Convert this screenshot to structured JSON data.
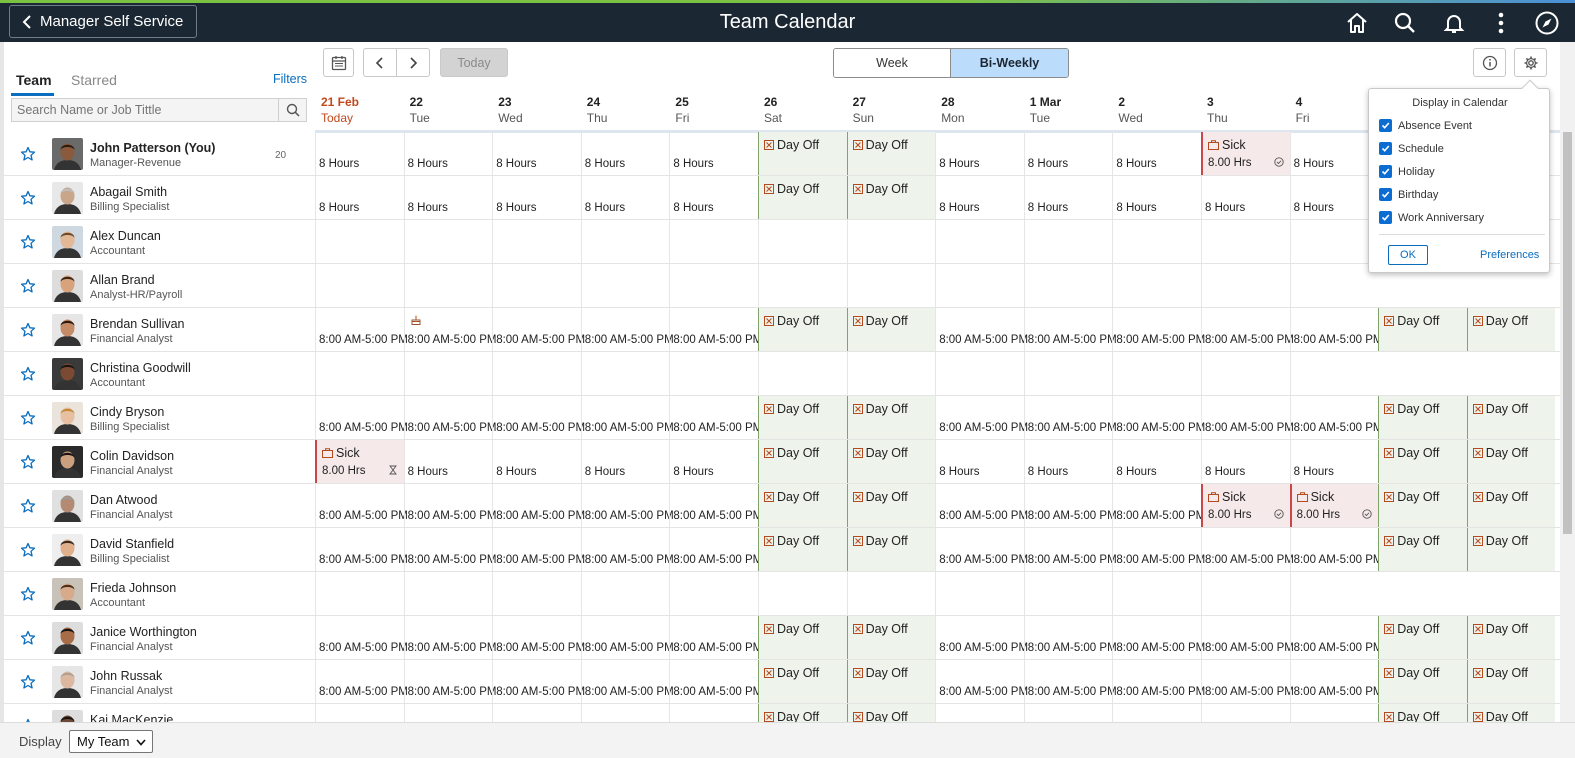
{
  "header": {
    "back_label": "Manager Self Service",
    "title": "Team Calendar",
    "icons": [
      "home-icon",
      "search-icon",
      "notifications-icon",
      "more-actions-icon",
      "navbar-icon"
    ]
  },
  "left": {
    "tabs": [
      {
        "label": "Team",
        "active": true
      },
      {
        "label": "Starred",
        "active": false
      }
    ],
    "filters_label": "Filters",
    "search_placeholder": "Search Name or Job Tittle"
  },
  "toolbar": {
    "today_label": "Today",
    "views": [
      {
        "label": "Week",
        "active": false
      },
      {
        "label": "Bi-Weekly",
        "active": true
      }
    ]
  },
  "dates": [
    {
      "num": "21 Feb",
      "day": "Today",
      "today": true
    },
    {
      "num": "22",
      "day": "Tue"
    },
    {
      "num": "23",
      "day": "Wed"
    },
    {
      "num": "24",
      "day": "Thu"
    },
    {
      "num": "25",
      "day": "Fri"
    },
    {
      "num": "26",
      "day": "Sat"
    },
    {
      "num": "27",
      "day": "Sun"
    },
    {
      "num": "28",
      "day": "Mon"
    },
    {
      "num": "1 Mar",
      "day": "Tue"
    },
    {
      "num": "2",
      "day": "Wed"
    },
    {
      "num": "3",
      "day": "Thu"
    },
    {
      "num": "4",
      "day": "Fri"
    }
  ],
  "labels": {
    "day_off": "Day Off",
    "sick": "Sick",
    "sick_hours": "8.00 Hrs",
    "hours": "8 Hours",
    "shift": "8:00 AM-5:00 PM"
  },
  "employees": [
    {
      "name": "John Patterson (You)",
      "job": "Manager-Revenue",
      "count": "20",
      "me": true,
      "sched": "hours",
      "sick": [
        10
      ],
      "sickStatus": "approved",
      "weekendExtra": false
    },
    {
      "name": "Abagail Smith",
      "job": "Billing Specialist",
      "sched": "hours",
      "sick": [],
      "weekendExtra": false
    },
    {
      "name": "Alex Duncan",
      "job": "Accountant",
      "sched": "none",
      "sick": [],
      "weekendExtra": false
    },
    {
      "name": "Allan Brand",
      "job": "Analyst-HR/Payroll",
      "sched": "none",
      "sick": [],
      "weekendExtra": false
    },
    {
      "name": "Brendan Sullivan",
      "job": "Financial Analyst",
      "sched": "shift",
      "sick": [],
      "birthday": 1,
      "weekendExtra": true
    },
    {
      "name": "Christina Goodwill",
      "job": "Accountant",
      "sched": "none",
      "sick": [],
      "weekendExtra": false
    },
    {
      "name": "Cindy Bryson",
      "job": "Billing Specialist",
      "sched": "shift",
      "sick": [],
      "weekendExtra": true
    },
    {
      "name": "Colin Davidson",
      "job": "Financial Analyst",
      "sched": "hours",
      "sick": [
        0
      ],
      "sickStatus": "pending",
      "weekendExtra": true
    },
    {
      "name": "Dan Atwood",
      "job": "Financial Analyst",
      "sched": "shift",
      "sick": [
        10,
        11
      ],
      "sickStatus": "approved",
      "weekendExtra": true
    },
    {
      "name": "David Stanfield",
      "job": "Billing Specialist",
      "sched": "shift",
      "sick": [],
      "weekendExtra": true
    },
    {
      "name": "Frieda Johnson",
      "job": "Accountant",
      "sched": "none",
      "sick": [],
      "weekendExtra": false
    },
    {
      "name": "Janice Worthington",
      "job": "Financial Analyst",
      "sched": "shift",
      "sick": [],
      "weekendExtra": true
    },
    {
      "name": "John Russak",
      "job": "Financial Analyst",
      "sched": "shift",
      "sick": [],
      "weekendExtra": true
    },
    {
      "name": "Kai MacKenzie",
      "job": "",
      "sched": "shift",
      "sick": [],
      "weekendExtra": true
    }
  ],
  "popup": {
    "title": "Display in Calendar",
    "options": [
      {
        "label": "Absence Event",
        "checked": true
      },
      {
        "label": "Schedule",
        "checked": true
      },
      {
        "label": "Holiday",
        "checked": true
      },
      {
        "label": "Birthday",
        "checked": true
      },
      {
        "label": "Work Anniversary",
        "checked": true
      }
    ],
    "ok_label": "OK",
    "preferences_label": "Preferences"
  },
  "footer": {
    "display_label": "Display",
    "display_value": "My Team"
  },
  "colors": {
    "header_bg": "#1b2733",
    "accent": "#0a6dbf",
    "today": "#c2491d",
    "weekend_bg": "#eef3ec",
    "sick_bg": "#f6e9e9",
    "sick_border": "#c9474b",
    "active_view": "#bcdcfb"
  }
}
